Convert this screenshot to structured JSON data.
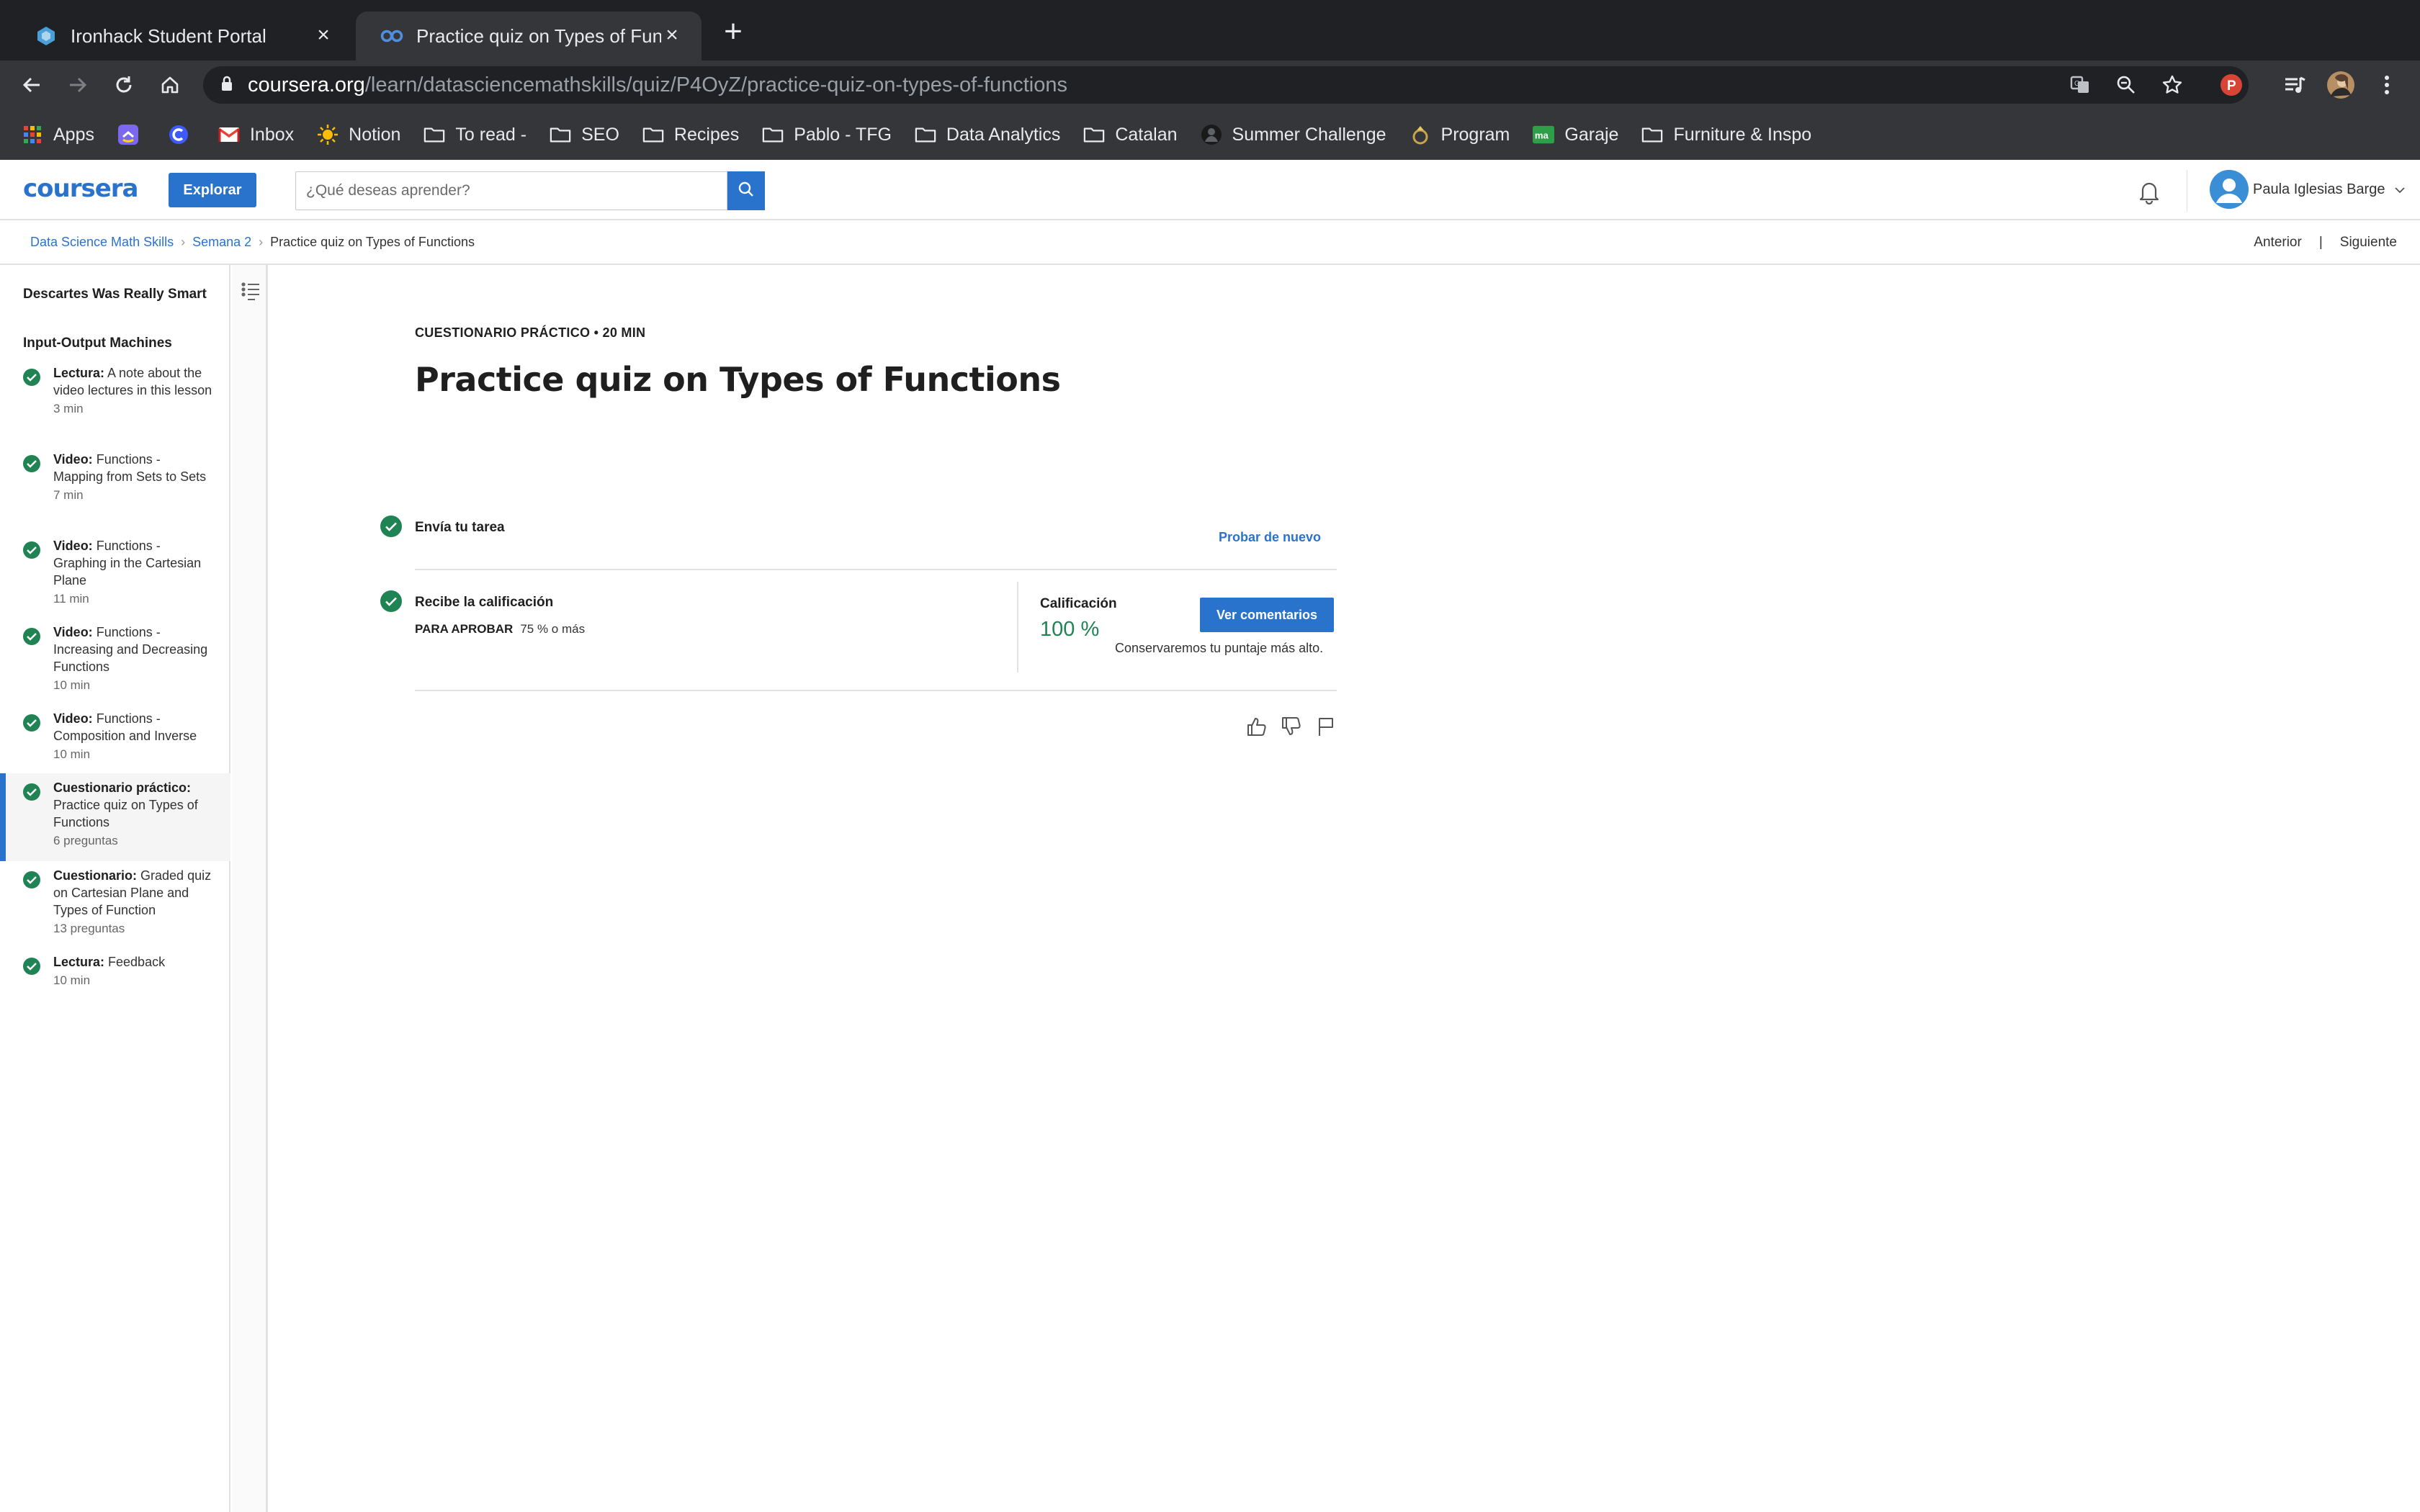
{
  "browser": {
    "tabs": [
      {
        "title": "Ironhack Student Portal",
        "active": false
      },
      {
        "title": "Practice quiz on Types of Functions",
        "active": true
      }
    ],
    "url_host": "coursera.org",
    "url_path": "/learn/datasciencemathskills/quiz/P4OyZ/practice-quiz-on-types-of-functions",
    "bookmarks": [
      {
        "label": "Apps",
        "icon": "apps-grid-icon"
      },
      {
        "label": "",
        "icon": "clickup-icon"
      },
      {
        "label": "",
        "icon": "circle-app-icon"
      },
      {
        "label": "Inbox",
        "icon": "gmail-icon"
      },
      {
        "label": "Notion",
        "icon": "sun-icon"
      },
      {
        "label": "To read -",
        "icon": "folder-icon"
      },
      {
        "label": "SEO",
        "icon": "folder-icon"
      },
      {
        "label": "Recipes",
        "icon": "folder-icon"
      },
      {
        "label": "Pablo - TFG",
        "icon": "folder-icon"
      },
      {
        "label": "Data Analytics",
        "icon": "folder-icon"
      },
      {
        "label": "Catalan",
        "icon": "folder-icon"
      },
      {
        "label": "Summer Challenge",
        "icon": "person-icon"
      },
      {
        "label": "Program",
        "icon": "ring-icon"
      },
      {
        "label": "Garaje",
        "icon": "ma-icon"
      },
      {
        "label": "Furniture & Inspo",
        "icon": "folder-icon"
      }
    ]
  },
  "header": {
    "logo": "coursera",
    "explore_label": "Explorar",
    "search_placeholder": "¿Qué deseas aprender?",
    "user_name": "Paula Iglesias Barge"
  },
  "breadcrumb": {
    "course": "Data Science Math Skills",
    "week": "Semana 2",
    "current": "Practice quiz on Types of Functions"
  },
  "nav": {
    "prev_label": "Anterior",
    "next_label": "Siguiente"
  },
  "sidebar": {
    "section_titles": [
      "Descartes Was Really Smart",
      "Input-Output Machines"
    ],
    "items": [
      {
        "type": "Lectura:",
        "title": "A note about the video lectures in this lesson",
        "meta": "3 min",
        "completed": true,
        "active": false
      },
      {
        "type": "Video:",
        "title": "Functions - Mapping from Sets to Sets",
        "meta": "7 min",
        "completed": true,
        "active": false
      },
      {
        "type": "Video:",
        "title": "Functions - Graphing in the Cartesian Plane",
        "meta": "11 min",
        "completed": true,
        "active": false
      },
      {
        "type": "Video:",
        "title": "Functions - Increasing and Decreasing Functions",
        "meta": "10 min",
        "completed": true,
        "active": false
      },
      {
        "type": "Video:",
        "title": "Functions - Composition and Inverse",
        "meta": "10 min",
        "completed": true,
        "active": false
      },
      {
        "type": "Cuestionario práctico:",
        "title": "Practice quiz on Types of Functions",
        "meta": "6 preguntas",
        "completed": true,
        "active": true
      },
      {
        "type": "Cuestionario:",
        "title": "Graded quiz on Cartesian Plane and Types of Function",
        "meta": "13 preguntas",
        "completed": true,
        "active": false
      },
      {
        "type": "Lectura:",
        "title": "Feedback",
        "meta": "10 min",
        "completed": true,
        "active": false
      }
    ]
  },
  "main": {
    "kicker": "CUESTIONARIO PRÁCTICO • 20 MIN",
    "title": "Practice quiz on Types of Functions",
    "step1_label": "Envía tu tarea",
    "retry_label": "Probar de nuevo",
    "step2_label": "Recibe la calificación",
    "pass_label": "PARA APROBAR",
    "pass_value": "75 % o más",
    "grade_label": "Calificación",
    "grade_value": "100 %",
    "feedback_button": "Ver comentarios",
    "keep_note": "Conservaremos tu puntaje más alto."
  },
  "colors": {
    "brand_blue": "#2a73cc",
    "success_green": "#1f8354",
    "chrome_dark": "#202124",
    "chrome_mid": "#35363a"
  }
}
